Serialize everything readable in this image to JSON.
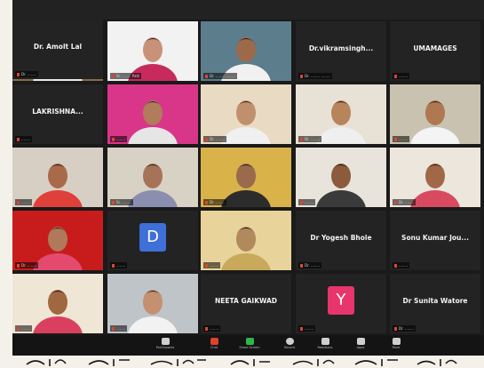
{
  "window": {
    "name": "zoom-meeting-gallery-view"
  },
  "tiles": [
    {
      "type": "video",
      "label": "",
      "speaking": false,
      "skin": "#c9a07c",
      "shirt": "#e8e8e8",
      "bg": "#8a6a4a"
    },
    {
      "type": "video",
      "label": "Sr. ........ Patil",
      "speaking": false,
      "skin": "#c89278",
      "shirt": "#c72b5e",
      "bg": "#f2f2f2"
    },
    {
      "type": "video",
      "label": "Dr. ........ ........",
      "speaking": false,
      "skin": "#9c6a4a",
      "shirt": "#f1f1f1",
      "bg": "#5b7d8c"
    },
    {
      "type": "name",
      "name": "Dr.vikramsingh...",
      "label": "Dr. ........ ........"
    },
    {
      "type": "name",
      "name": "UMAMAGES",
      "label": "........"
    },
    {
      "type": "name",
      "name": "LAKRISHNA...",
      "label": "........"
    },
    {
      "type": "video",
      "label": "........",
      "speaking": true,
      "skin": "#b07c5c",
      "shirt": "#e6e6e6",
      "bg": "#d9368a"
    },
    {
      "type": "video",
      "label": "Dr. ........",
      "speaking": false,
      "skin": "#c0906c",
      "shirt": "#f0f0f0",
      "bg": "#e9dbc3"
    },
    {
      "type": "video",
      "label": "Dr. ........",
      "speaking": false,
      "skin": "#b8845c",
      "shirt": "#efefef",
      "bg": "#e8e2d6"
    },
    {
      "type": "video",
      "label": "........",
      "speaking": false,
      "skin": "#b07850",
      "shirt": "#f4f4f4",
      "bg": "#c9c2b0"
    },
    {
      "type": "video",
      "label": "........",
      "speaking": false,
      "skin": "#a86a48",
      "shirt": "#e0403a",
      "bg": "#d8cfc4"
    },
    {
      "type": "video",
      "label": "Sr. ........",
      "speaking": false,
      "skin": "#a67358",
      "shirt": "#8a8fb0",
      "bg": "#d8d2c4"
    },
    {
      "type": "video",
      "label": "Dr. ........",
      "speaking": false,
      "skin": "#9a6a4c",
      "shirt": "#2c2c2c",
      "bg": "#d9b24a"
    },
    {
      "type": "video",
      "label": "........",
      "speaking": false,
      "skin": "#8c5a3c",
      "shirt": "#3a3a3a",
      "bg": "#e8e4dc"
    },
    {
      "type": "video",
      "label": "Dr. ........",
      "speaking": false,
      "skin": "#a06848",
      "shirt": "#d84a60",
      "bg": "#ece6dd"
    },
    {
      "type": "video",
      "label": "Dr. ........",
      "speaking": false,
      "skin": "#b07a5a",
      "shirt": "#e44a6e",
      "bg": "#c81c1c"
    },
    {
      "type": "avatar",
      "letter": "D",
      "color": "#3f6fd8",
      "label": "........"
    },
    {
      "type": "video",
      "label": "........",
      "speaking": false,
      "skin": "#b08a5c",
      "shirt": "#c9a95c",
      "bg": "#e8d39a"
    },
    {
      "type": "name",
      "name": "Dr Yogesh Bhole",
      "label": "Dr. ........"
    },
    {
      "type": "name",
      "name": "Sonu Kumar Jou...",
      "label": "........"
    },
    {
      "type": "video",
      "label": "........",
      "speaking": false,
      "skin": "#a06840",
      "shirt": "#d94060",
      "bg": "#efe6d6"
    },
    {
      "type": "video",
      "label": "........",
      "speaking": false,
      "skin": "#c49070",
      "shirt": "#f2f2f2",
      "bg": "#bfc4c8"
    },
    {
      "type": "name",
      "name": "NEETA GAIKWAD",
      "label": "........"
    },
    {
      "type": "avatar",
      "letter": "Y",
      "color": "#e8356b",
      "label": "........"
    },
    {
      "type": "name",
      "name": "Dr Sunita Watore",
      "label": "Dr. ........"
    },
    {
      "type": "name",
      "name": "Dr. Amolt Lal",
      "label": "Dr. ........"
    }
  ],
  "toolbar": {
    "buttons": [
      {
        "name": "participants-icon",
        "label": "Participants",
        "color": "#cfcfcf"
      },
      {
        "name": "chat-icon",
        "label": "Chat",
        "color": "#e0402c"
      },
      {
        "name": "share-screen-icon",
        "label": "Share Screen",
        "color": "#2db84a"
      },
      {
        "name": "record-icon",
        "label": "Record",
        "color": "#cfcfcf"
      },
      {
        "name": "reactions-icon",
        "label": "Reactions",
        "color": "#cfcfcf"
      },
      {
        "name": "apps-icon",
        "label": "Apps",
        "color": "#cfcfcf"
      },
      {
        "name": "more-icon",
        "label": "More",
        "color": "#cfcfcf"
      }
    ]
  },
  "caption": {
    "color": "#1a1a1a"
  }
}
